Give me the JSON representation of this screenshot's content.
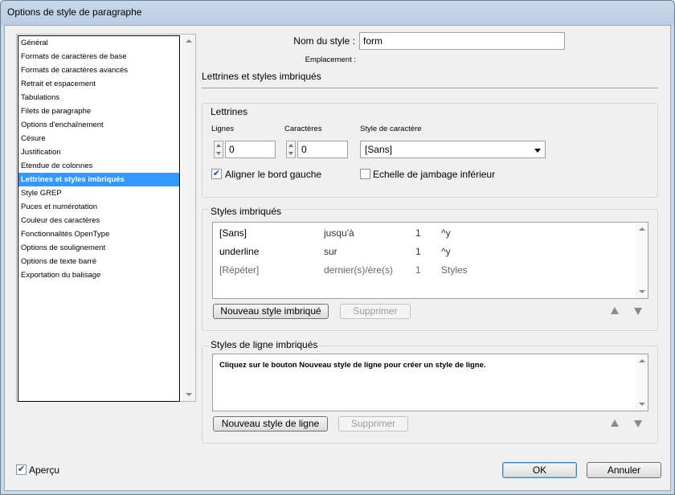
{
  "window": {
    "title": "Options de style de paragraphe"
  },
  "sidebar": {
    "items": [
      {
        "label": "Général",
        "selected": false
      },
      {
        "label": "Formats de caractères de base",
        "selected": false
      },
      {
        "label": "Formats de caractères avancés",
        "selected": false
      },
      {
        "label": "Retrait et espacement",
        "selected": false
      },
      {
        "label": "Tabulations",
        "selected": false
      },
      {
        "label": "Filets de paragraphe",
        "selected": false
      },
      {
        "label": "Options d'enchaînement",
        "selected": false
      },
      {
        "label": "Césure",
        "selected": false
      },
      {
        "label": "Justification",
        "selected": false
      },
      {
        "label": "Etendue de colonnes",
        "selected": false
      },
      {
        "label": "Lettrines et styles imbriqués",
        "selected": true
      },
      {
        "label": "Style GREP",
        "selected": false
      },
      {
        "label": "Puces et numérotation",
        "selected": false
      },
      {
        "label": "Couleur des caractères",
        "selected": false
      },
      {
        "label": "Fonctionnalités OpenType",
        "selected": false
      },
      {
        "label": "Options de soulignement",
        "selected": false
      },
      {
        "label": "Options de texte barré",
        "selected": false
      },
      {
        "label": "Exportation du balisage",
        "selected": false
      }
    ]
  },
  "header": {
    "style_name_label": "Nom du style :",
    "style_name_value": "form",
    "location_label": "Emplacement :",
    "section_title": "Lettrines et styles imbriqués"
  },
  "dropcaps": {
    "title": "Lettrines",
    "lines_label": "Lignes",
    "lines_value": "0",
    "chars_label": "Caractères",
    "chars_value": "0",
    "char_style_label": "Style de caractère",
    "char_style_value": "[Sans]",
    "align_left_label": "Aligner le bord gauche",
    "align_left_checked": true,
    "scale_label": "Echelle de jambage inférieur",
    "scale_checked": false
  },
  "nested": {
    "title": "Styles imbriqués",
    "rows": [
      {
        "style": "[Sans]",
        "mode": "jusqu'à",
        "count": "1",
        "target": "^y",
        "greyed": false
      },
      {
        "style": "underline",
        "mode": "sur",
        "count": "1",
        "target": "^y",
        "greyed": false
      },
      {
        "style": "[Répéter]",
        "mode": "dernier(s)/ère(s)",
        "count": "1",
        "target": "Styles",
        "greyed": true
      }
    ],
    "new_button": "Nouveau style imbriqué",
    "delete_button": "Supprimer"
  },
  "nested_line": {
    "title": "Styles de ligne imbriqués",
    "hint": "Cliquez sur le bouton Nouveau style de ligne pour créer un style de ligne.",
    "new_button": "Nouveau style de ligne",
    "delete_button": "Supprimer"
  },
  "footer": {
    "preview_label": "Aperçu",
    "preview_checked": true,
    "ok_button": "OK",
    "cancel_button": "Annuler"
  },
  "colors": {
    "selection": "#3399ff",
    "window_frame": "#b9cde3"
  }
}
